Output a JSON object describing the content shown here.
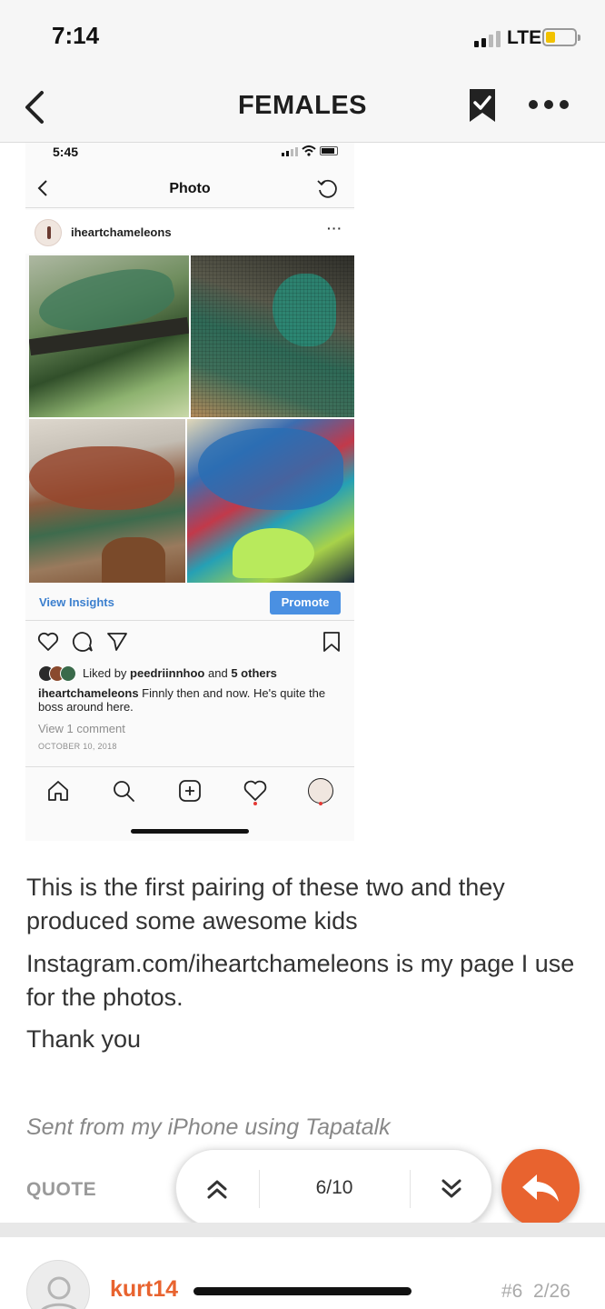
{
  "status_bar": {
    "time": "7:14",
    "network": "LTE"
  },
  "nav": {
    "title": "FEMALES"
  },
  "screenshot": {
    "status_time": "5:45",
    "header_title": "Photo",
    "username": "iheartchameleons",
    "more": "···",
    "view_insights": "View Insights",
    "promote": "Promote",
    "liked_prefix": "Liked by",
    "liked_user": "peedriinnhoo",
    "liked_and": "and",
    "liked_others": "5 others",
    "caption_user": "iheartchameleons",
    "caption_text": "Finnly then and now. He's quite the boss around here.",
    "view_comment": "View 1 comment",
    "date": "OCTOBER 10, 2018"
  },
  "post": {
    "paragraphs": [
      "This is the first pairing of these two and they produced some awesome kids",
      "Instagram.com/iheartchameleons is my page I use for the photos.",
      "Thank you"
    ],
    "signature": "Sent from my iPhone using Tapatalk",
    "quote_label": "QUOTE"
  },
  "pager": {
    "text": "6/10"
  },
  "next_post": {
    "username": "kurt14",
    "post_number": "#6",
    "date": "2/26"
  },
  "colors": {
    "accent": "#e8632f",
    "instagram_blue": "#4a90e2",
    "notification_dot": "#e53935"
  },
  "icons": {
    "back": "chevron-left-icon",
    "bookmark": "bookmark-check-icon",
    "more": "more-dots-icon",
    "pager_up": "double-chevron-up-icon",
    "pager_down": "double-chevron-down-icon",
    "reply": "reply-arrow-icon",
    "user": "user-icon"
  }
}
